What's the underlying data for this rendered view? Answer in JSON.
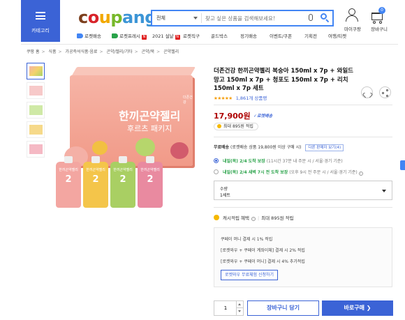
{
  "header": {
    "category_label": "카테고리",
    "logo": "coupang",
    "search": {
      "category": "전체",
      "placeholder": "찾고 싶은 상품을 검색해보세요!"
    },
    "my_coupang_label": "마이쿠팡",
    "cart_label": "장바구니",
    "cart_count": "0",
    "subnav": [
      "로켓배송",
      "로켓프레시",
      "2021 설날",
      "로켓직구",
      "골드박스",
      "정기배송",
      "이벤트/쿠폰",
      "기획전",
      "여행/티켓"
    ]
  },
  "breadcrumb": [
    "쿠팡 홈",
    "식품",
    "가공즉석식품·음료",
    "곤약/젤리/기타",
    "곤약/묵",
    "곤약젤리"
  ],
  "image": {
    "box_title_line1": "한끼곤약젤리",
    "box_title_line2": "후르츠 패키지",
    "box_brand": "더존건강",
    "pouch_label": "한끼곤약젤리",
    "pouch_number": "2"
  },
  "product": {
    "title": "더존건강 한끼곤약젤리 복숭아 150ml x 7p + 와일드 망고 150ml x 7p + 청포도 150ml x 7p + 리치 150ml x 7p 세트",
    "stars": "★★★★★",
    "review_count": "1,861개 상품평",
    "price": "17,900원",
    "rocket_badge": "로켓배송",
    "points": "최대 895원 적립"
  },
  "shipping": {
    "free_label": "무료배송",
    "free_text": "(로켓배송 상품 19,800원 이상 구매 시)",
    "compare_btn": "다른 판매자 보기(4)",
    "option1": {
      "date": "내일(목) 2/4",
      "guarantee": "도착 보장",
      "note": "(11시간 37분 내 주문 시 / 서울⋅경기 기준)"
    },
    "option2": {
      "date": "내일(목) 2/4 새벽 7시 전",
      "guarantee": "도착 보장",
      "note": "(오후 9시 전 주문 시 / 서울⋅경기 기준)"
    }
  },
  "quantity_select": {
    "label": "수량",
    "value": "1세트"
  },
  "cash": {
    "label": "캐시적립 혜택",
    "max": "최대 895원 적립"
  },
  "promo": {
    "line1": "쿠페이 머니 결제 시 1% 적립",
    "line2": "[로켓와우 + 쿠페이 계좌이체] 결제 시 2% 적립",
    "line3": "[로켓와우 + 쿠페이 머니] 결제 시 4% 추가적립",
    "button": "로켓와우 무료체험 신청하기"
  },
  "actions": {
    "qty": "1",
    "add_to_cart": "장바구니 담기",
    "buy_now": "바로구매 ❯"
  },
  "colors": {
    "accent": "#3b63d6",
    "price": "#ae0000",
    "rocket": "#3b63d6",
    "arrival_green": "#2aa34a"
  }
}
